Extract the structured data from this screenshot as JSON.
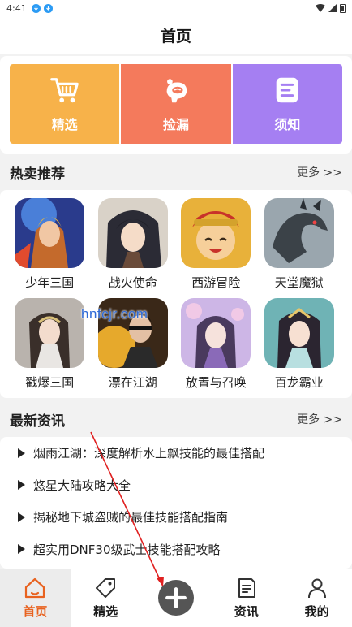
{
  "status_bar": {
    "time": "4:41"
  },
  "header": {
    "title": "首页"
  },
  "categories": [
    {
      "label": "精选",
      "icon": "shopping-cart-icon",
      "color": "#f7b24a"
    },
    {
      "label": "捡漏",
      "icon": "piggy-bank-icon",
      "color": "#f47a5c"
    },
    {
      "label": "须知",
      "icon": "notice-document-icon",
      "color": "#a57ff2"
    }
  ],
  "hot": {
    "title": "热卖推荐",
    "more": "更多 >>",
    "games": [
      {
        "name": "少年三国"
      },
      {
        "name": "战火使命"
      },
      {
        "name": "西游冒险"
      },
      {
        "name": "天堂魔狱"
      },
      {
        "name": "戳爆三国"
      },
      {
        "name": "漂在江湖"
      },
      {
        "name": "放置与召唤"
      },
      {
        "name": "百龙霸业"
      }
    ]
  },
  "watermark": "hnfcjr.com",
  "news": {
    "title": "最新资讯",
    "more": "更多 >>",
    "items": [
      "烟雨江湖：深度解析水上飘技能的最佳搭配",
      "悠星大陆攻略大全",
      "揭秘地下城盗贼的最佳技能搭配指南",
      "超实用DNF30级武士技能搭配攻略"
    ]
  },
  "nav": {
    "home": "首页",
    "featured": "精选",
    "news": "资讯",
    "mine": "我的"
  },
  "colors": {
    "active": "#e8621f",
    "background": "#f2f2f2"
  }
}
